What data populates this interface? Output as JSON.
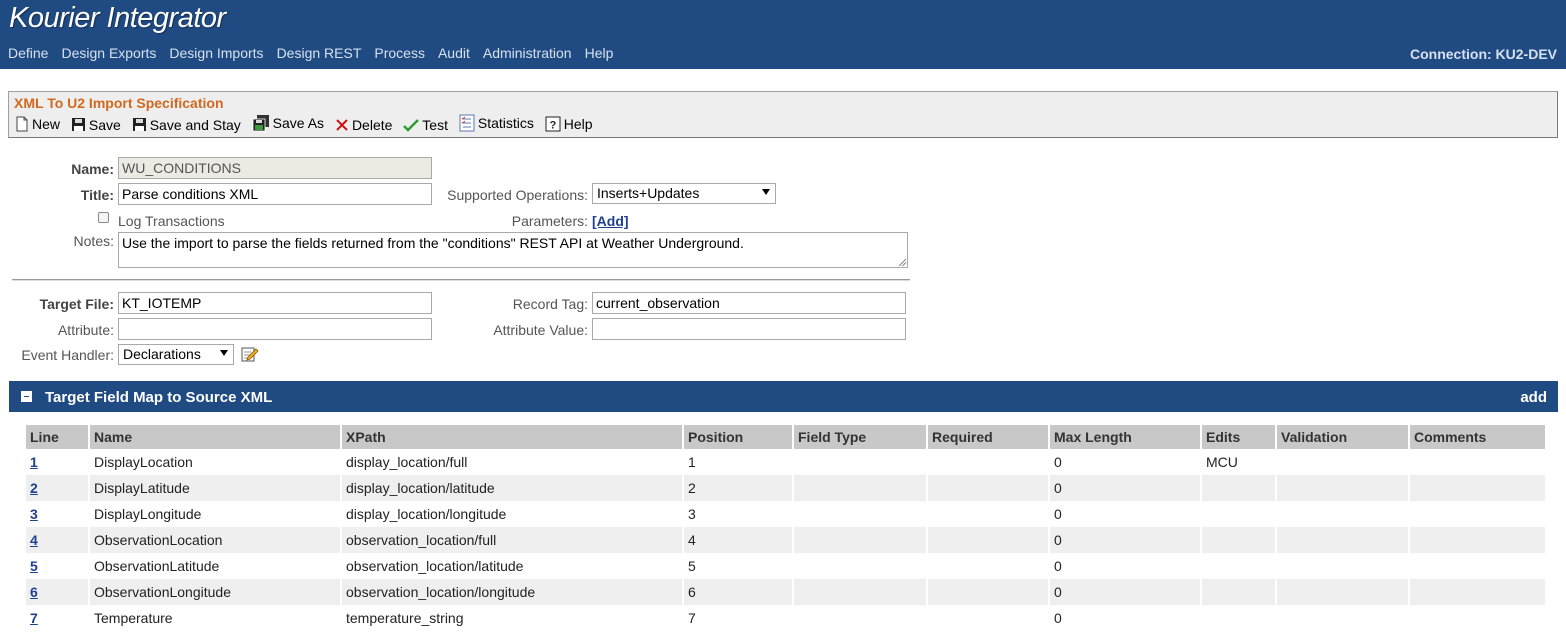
{
  "app": {
    "title": "Kourier Integrator",
    "connection": "Connection: KU2-DEV",
    "nav": [
      "Define",
      "Design Exports",
      "Design Imports",
      "Design REST",
      "Process",
      "Audit",
      "Administration",
      "Help"
    ]
  },
  "panel": {
    "title": "XML To U2 Import Specification",
    "tools": {
      "new": "New",
      "save": "Save",
      "save_stay": "Save and Stay",
      "save_as": "Save As",
      "delete": "Delete",
      "test": "Test",
      "statistics": "Statistics",
      "help": "Help"
    }
  },
  "form": {
    "name_label": "Name:",
    "name_value": "WU_CONDITIONS",
    "title_label": "Title:",
    "title_value": "Parse conditions XML",
    "supported_ops_label": "Supported Operations:",
    "supported_ops_value": "Inserts+Updates",
    "log_transactions_label": "Log Transactions",
    "parameters_label": "Parameters:",
    "parameters_add": "[Add]",
    "notes_label": "Notes:",
    "notes_value": "Use the import to parse the fields returned from the \"conditions\" REST API at Weather Underground.",
    "target_file_label": "Target File:",
    "target_file_value": "KT_IOTEMP",
    "record_tag_label": "Record Tag:",
    "record_tag_value": "current_observation",
    "attribute_label": "Attribute:",
    "attribute_value": "",
    "attribute_value_label": "Attribute Value:",
    "attribute_value_value": "",
    "event_handler_label": "Event Handler:",
    "event_handler_value": "Declarations"
  },
  "section": {
    "title": "Target Field Map to Source XML",
    "add": "add"
  },
  "table": {
    "headers": {
      "line": "Line",
      "name": "Name",
      "xpath": "XPath",
      "position": "Position",
      "field_type": "Field Type",
      "required": "Required",
      "max_length": "Max Length",
      "edits": "Edits",
      "validation": "Validation",
      "comments": "Comments"
    },
    "rows": [
      {
        "line": "1",
        "name": "DisplayLocation",
        "xpath": "display_location/full",
        "position": "1",
        "field_type": "",
        "required": "",
        "max_length": "0",
        "edits": "MCU",
        "validation": "",
        "comments": ""
      },
      {
        "line": "2",
        "name": "DisplayLatitude",
        "xpath": "display_location/latitude",
        "position": "2",
        "field_type": "",
        "required": "",
        "max_length": "0",
        "edits": "",
        "validation": "",
        "comments": ""
      },
      {
        "line": "3",
        "name": "DisplayLongitude",
        "xpath": "display_location/longitude",
        "position": "3",
        "field_type": "",
        "required": "",
        "max_length": "0",
        "edits": "",
        "validation": "",
        "comments": ""
      },
      {
        "line": "4",
        "name": "ObservationLocation",
        "xpath": "observation_location/full",
        "position": "4",
        "field_type": "",
        "required": "",
        "max_length": "0",
        "edits": "",
        "validation": "",
        "comments": ""
      },
      {
        "line": "5",
        "name": "ObservationLatitude",
        "xpath": "observation_location/latitude",
        "position": "5",
        "field_type": "",
        "required": "",
        "max_length": "0",
        "edits": "",
        "validation": "",
        "comments": ""
      },
      {
        "line": "6",
        "name": "ObservationLongitude",
        "xpath": "observation_location/longitude",
        "position": "6",
        "field_type": "",
        "required": "",
        "max_length": "0",
        "edits": "",
        "validation": "",
        "comments": ""
      },
      {
        "line": "7",
        "name": "Temperature",
        "xpath": "temperature_string",
        "position": "7",
        "field_type": "",
        "required": "",
        "max_length": "0",
        "edits": "",
        "validation": "",
        "comments": ""
      }
    ]
  },
  "colors": {
    "header_bg": "#1f4a82",
    "panel_title": "#d2691e",
    "link": "#1f3f8f"
  },
  "icons": [
    "new-doc-icon",
    "save-icon",
    "save-stay-icon",
    "save-as-icon",
    "delete-icon",
    "test-check-icon",
    "statistics-icon",
    "help-icon",
    "edit-handler-icon",
    "collapse-icon",
    "dropdown-arrow-icon"
  ]
}
